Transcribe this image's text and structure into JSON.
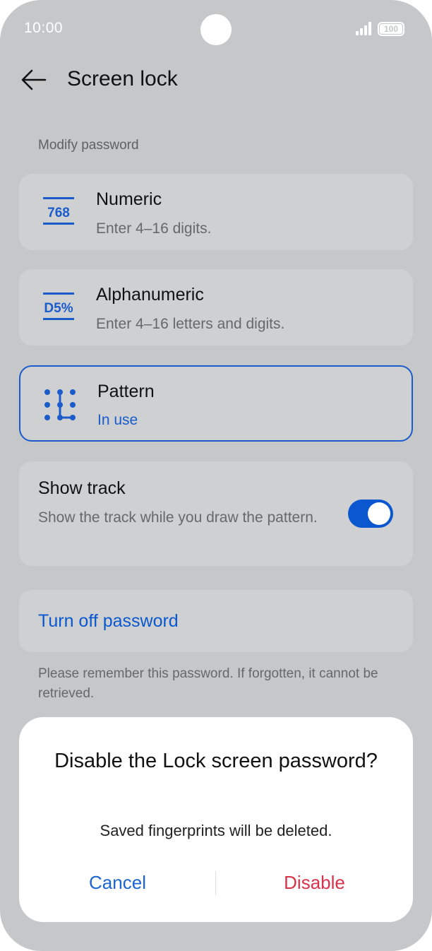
{
  "status_bar": {
    "time": "10:00",
    "battery": "100"
  },
  "header": {
    "title": "Screen lock"
  },
  "section": {
    "label": "Modify password"
  },
  "options": [
    {
      "title": "Numeric",
      "subtitle": "Enter 4–16 digits.",
      "icon_text": "768",
      "icon": "numeric-icon"
    },
    {
      "title": "Alphanumeric",
      "subtitle": "Enter 4–16 letters and digits.",
      "icon_text": "D5%",
      "icon": "alphanumeric-icon"
    },
    {
      "title": "Pattern",
      "subtitle": "In use",
      "icon": "pattern-icon",
      "selected": true
    }
  ],
  "show_track": {
    "title": "Show track",
    "description": "Show the track while you draw the pattern.",
    "enabled": true
  },
  "turn_off": {
    "label": "Turn off password"
  },
  "note": "Please remember this password. If forgotten, it cannot be retrieved.",
  "dialog": {
    "title": "Disable the Lock screen password?",
    "message": "Saved fingerprints will be deleted.",
    "cancel_label": "Cancel",
    "disable_label": "Disable"
  },
  "colors": {
    "accent": "#0b57d0",
    "danger": "#d8334a",
    "background_dimmed": "#c6c7c9"
  }
}
